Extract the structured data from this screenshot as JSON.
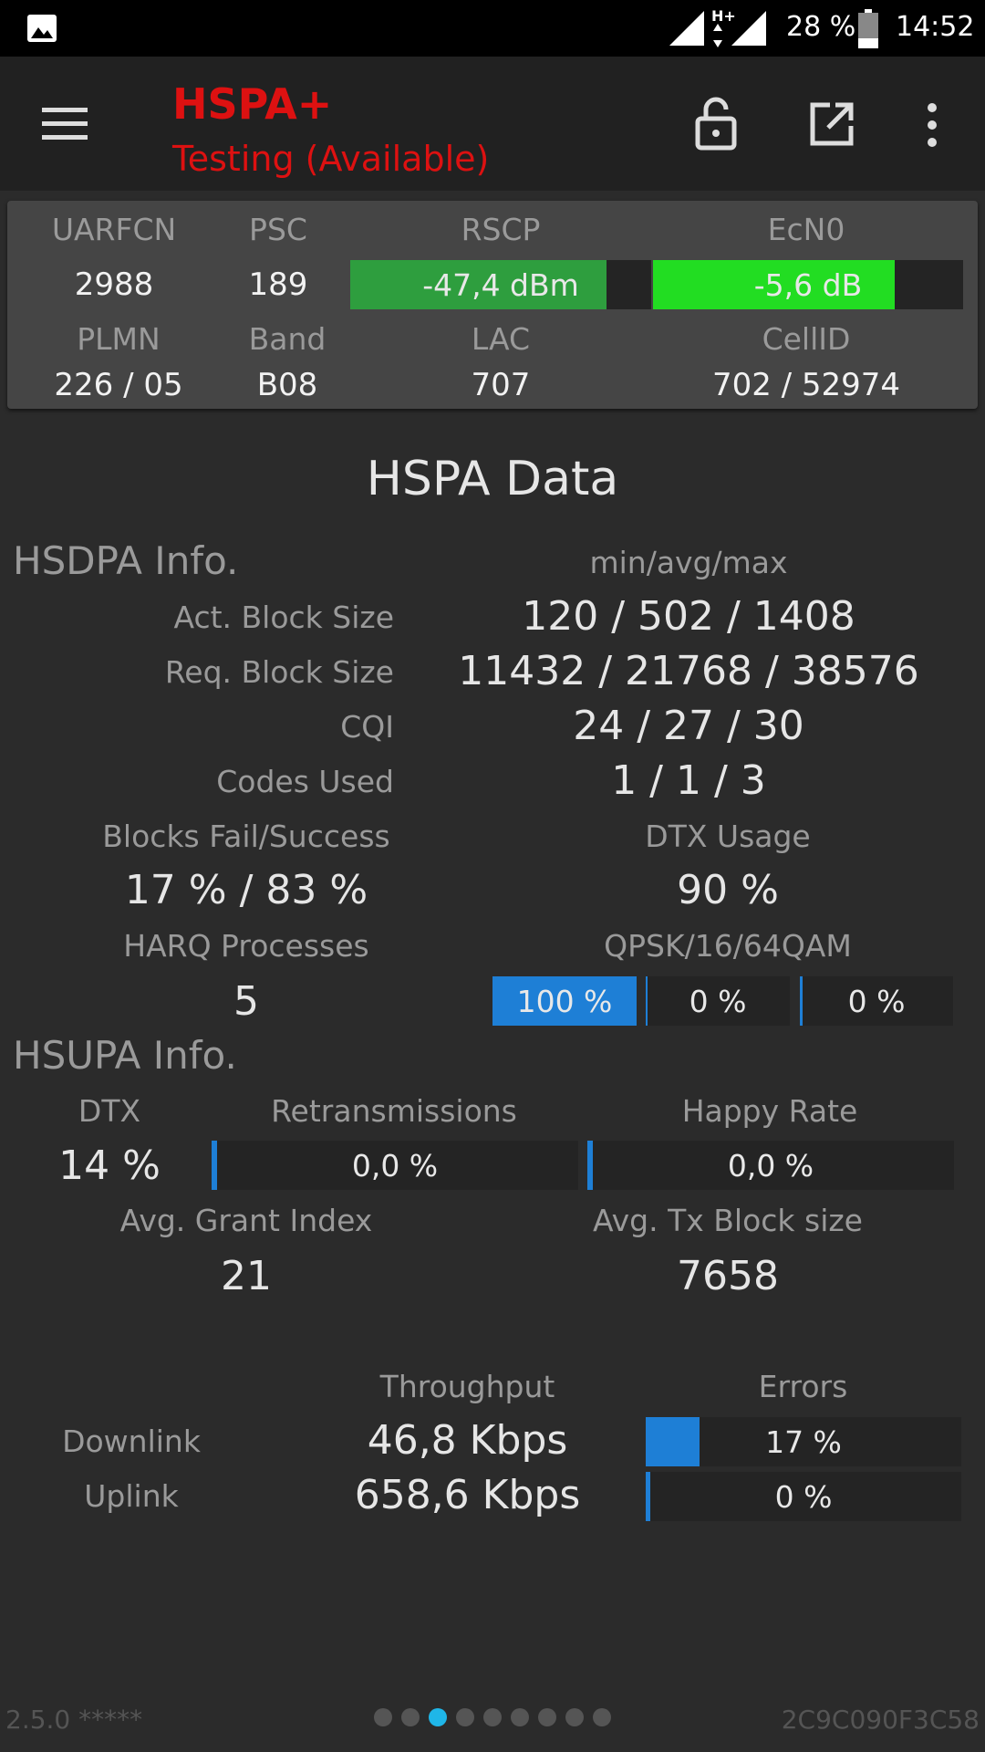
{
  "status_bar": {
    "battery": "28 %",
    "time": "14:52",
    "network_type": "H+"
  },
  "toolbar": {
    "title": "HSPA+",
    "subtitle": "Testing (Available)"
  },
  "cell_panel": {
    "labels": {
      "uarfcn": "UARFCN",
      "psc": "PSC",
      "rscp": "RSCP",
      "ecn0": "EcN0",
      "plmn": "PLMN",
      "band": "Band",
      "lac": "LAC",
      "cellid": "CellID"
    },
    "values": {
      "uarfcn": "2988",
      "psc": "189",
      "rscp": "-47,4 dBm",
      "ecn0": "-5,6 dB",
      "plmn": "226 / 05",
      "band": "B08",
      "lac": "707",
      "cellid": "702 / 52974"
    },
    "rscp_fill": 0.85,
    "ecn0_fill": 0.78,
    "colors": {
      "rscp": "#2e9e3e",
      "ecn0": "#22dd22"
    }
  },
  "hspa": {
    "heading": "HSPA Data",
    "hsdpa": {
      "title": "HSDPA Info.",
      "stat_header": "min/avg/max",
      "rows": [
        {
          "label": "Act. Block Size",
          "value": "120 / 502 / 1408"
        },
        {
          "label": "Req. Block Size",
          "value": "11432 / 21768 / 38576"
        },
        {
          "label": "CQI",
          "value": "24 / 27 / 30"
        },
        {
          "label": "Codes Used",
          "value": "1 / 1 / 3"
        }
      ],
      "blocks_label": "Blocks Fail/Success",
      "blocks_value": "17 % / 83 %",
      "dtx_label": "DTX Usage",
      "dtx_value": "90 %",
      "harq_label": "HARQ Processes",
      "harq_value": "5",
      "qam_label": "QPSK/16/64QAM",
      "qam": [
        {
          "value": "100 %",
          "fill": 1.0
        },
        {
          "value": "0 %",
          "fill": 0.0
        },
        {
          "value": "0 %",
          "fill": 0.0
        }
      ]
    },
    "hsupa": {
      "title": "HSUPA Info.",
      "dtx_label": "DTX",
      "dtx_value": "14 %",
      "retrans_label": "Retransmissions",
      "retrans_value": "0,0 %",
      "retrans_fill": 0.0,
      "happy_label": "Happy Rate",
      "happy_value": "0,0 %",
      "happy_fill": 0.0,
      "grant_label": "Avg. Grant Index",
      "grant_value": "21",
      "txblock_label": "Avg. Tx Block size",
      "txblock_value": "7658"
    }
  },
  "throughput": {
    "throughput_header": "Throughput",
    "errors_header": "Errors",
    "downlink_label": "Downlink",
    "downlink_value": "46,8 Kbps",
    "downlink_errors": "17 %",
    "downlink_error_fill": 0.17,
    "uplink_label": "Uplink",
    "uplink_value": "658,6 Kbps",
    "uplink_errors": "0 %",
    "uplink_error_fill": 0.0
  },
  "footer": {
    "version": "2.5.0 *****",
    "device_id": "2C9C090F3C58",
    "page_count": 9,
    "active_page": 3
  },
  "accent": "#1e7fd6"
}
